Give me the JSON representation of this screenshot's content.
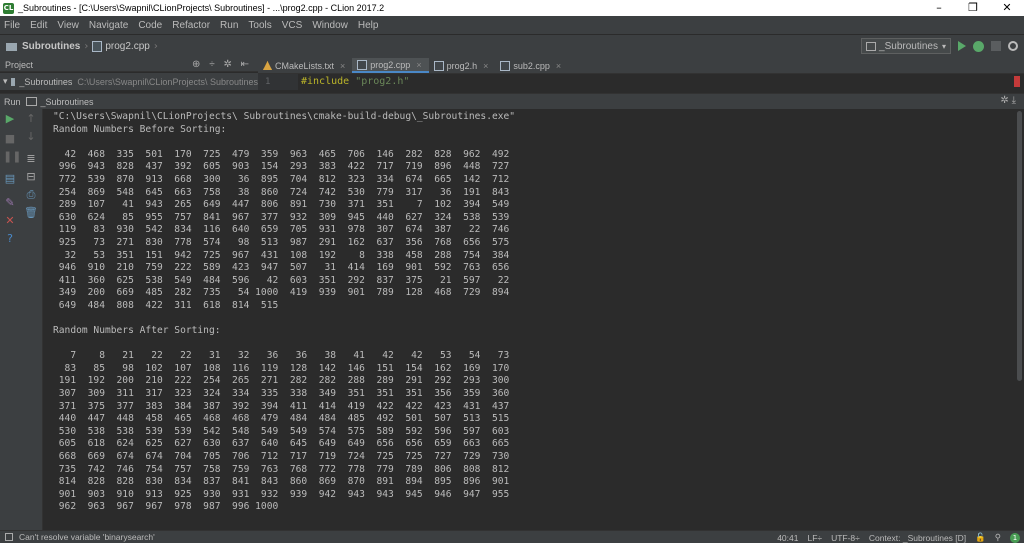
{
  "window": {
    "title": "_Subroutines - [C:\\Users\\Swapnil\\CLionProjects\\ Subroutines] - ...\\prog2.cpp - CLion 2017.2",
    "controls": [
      "–",
      "❐",
      "✕"
    ]
  },
  "menu": [
    "File",
    "Edit",
    "View",
    "Navigate",
    "Code",
    "Refactor",
    "Run",
    "Tools",
    "VCS",
    "Window",
    "Help"
  ],
  "navbar": {
    "project": "Subroutines",
    "file": "prog2.cpp",
    "run_config": "_Subroutines"
  },
  "project_panel": {
    "label": "Project",
    "root": "_Subroutines",
    "root_path": "C:\\Users\\Swapnil\\CLionProjects\\ Subroutines"
  },
  "editor": {
    "tabs": [
      {
        "label": "CMakeLists.txt",
        "active": false
      },
      {
        "label": "prog2.cpp",
        "active": true
      },
      {
        "label": "prog2.h",
        "active": false
      },
      {
        "label": "sub2.cpp",
        "active": false
      }
    ],
    "line_number": "1",
    "code_kw": "#include",
    "code_str": "\"prog2.h\""
  },
  "run_panel": {
    "label": "Run",
    "config": "_Subroutines"
  },
  "console": {
    "text": "\"C:\\Users\\Swapnil\\CLionProjects\\ Subroutines\\cmake-build-debug\\_Subroutines.exe\"\nRandom Numbers Before Sorting:\n\n  42  468  335  501  170  725  479  359  963  465  706  146  282  828  962  492\n 996  943  828  437  392  605  903  154  293  383  422  717  719  896  448  727\n 772  539  870  913  668  300   36  895  704  812  323  334  674  665  142  712\n 254  869  548  645  663  758   38  860  724  742  530  779  317   36  191  843\n 289  107   41  943  265  649  447  806  891  730  371  351    7  102  394  549\n 630  624   85  955  757  841  967  377  932  309  945  440  627  324  538  539\n 119   83  930  542  834  116  640  659  705  931  978  307  674  387   22  746\n 925   73  271  830  778  574   98  513  987  291  162  637  356  768  656  575\n  32   53  351  151  942  725  967  431  108  192    8  338  458  288  754  384\n 946  910  210  759  222  589  423  947  507   31  414  169  901  592  763  656\n 411  360  625  538  549  484  596   42  603  351  292  837  375   21  597   22\n 349  200  669  485  282  735   54 1000  419  939  901  789  128  468  729  894\n 649  484  808  422  311  618  814  515\n\nRandom Numbers After Sorting:\n\n   7    8   21   22   22   31   32   36   36   38   41   42   42   53   54   73\n  83   85   98  102  107  108  116  119  128  142  146  151  154  162  169  170\n 191  192  200  210  222  254  265  271  282  282  288  289  291  292  293  300\n 307  309  311  317  323  324  334  335  338  349  351  351  351  356  359  360\n 371  375  377  383  384  387  392  394  411  414  419  422  422  423  431  437\n 440  447  448  458  465  468  468  479  484  484  485  492  501  507  513  515\n 530  538  538  539  539  542  548  549  549  574  575  589  592  596  597  603\n 605  618  624  625  627  630  637  640  645  649  649  656  656  659  663  665\n 668  669  674  674  704  705  706  712  717  719  724  725  725  727  729  730\n 735  742  746  754  757  758  759  763  768  772  778  779  789  806  808  812\n 814  828  828  830  834  837  841  843  860  869  870  891  894  895  896  901\n 901  903  910  913  925  930  931  932  939  942  943  943  945  946  947  955\n 962  963  967  967  978  987  996 1000"
  },
  "status": {
    "message": "Can't resolve variable 'binarysearch'",
    "position": "40:41",
    "line_sep": "LF÷",
    "encoding": "UTF-8÷",
    "context": "Context: _Subroutines [D]"
  },
  "colors": {
    "accent": "#4a88c7",
    "run_green": "#59a869",
    "error_red": "#c43a3a"
  },
  "icons": [
    "clion-app-icon",
    "folder-icon",
    "file-icon",
    "run-icon",
    "debug-icon",
    "stop-icon",
    "search-icon",
    "gear-icon",
    "close-icon"
  ]
}
